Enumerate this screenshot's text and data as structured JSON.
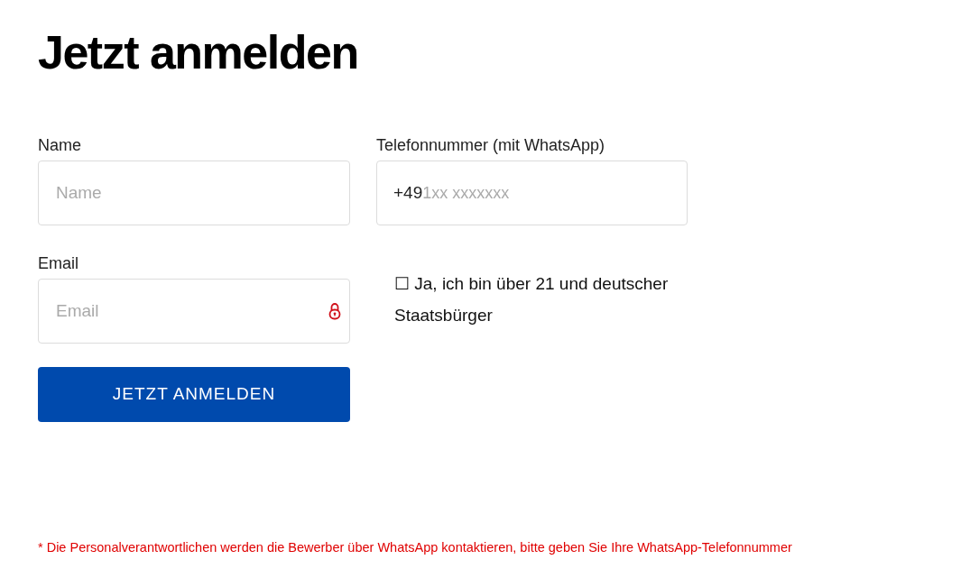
{
  "title": "Jetzt anmelden",
  "fields": [
    {
      "kind": "text",
      "label": "Name",
      "placeholder": "Name"
    },
    {
      "kind": "phone",
      "label": "Telefonnummer (mit WhatsApp)",
      "value": "+49",
      "hint": "1xx xxxxxxx"
    },
    {
      "kind": "email",
      "label": "Email",
      "placeholder": "Email"
    }
  ],
  "consent": "☐ Ja, ich bin über 21 und deutscher Staatsbürger",
  "submit": "JETZT ANMELDEN",
  "footnote": "* Die Personalverantwortlichen werden die Bewerber über WhatsApp kontaktieren, bitte geben Sie Ihre WhatsApp-Telefonnummer"
}
